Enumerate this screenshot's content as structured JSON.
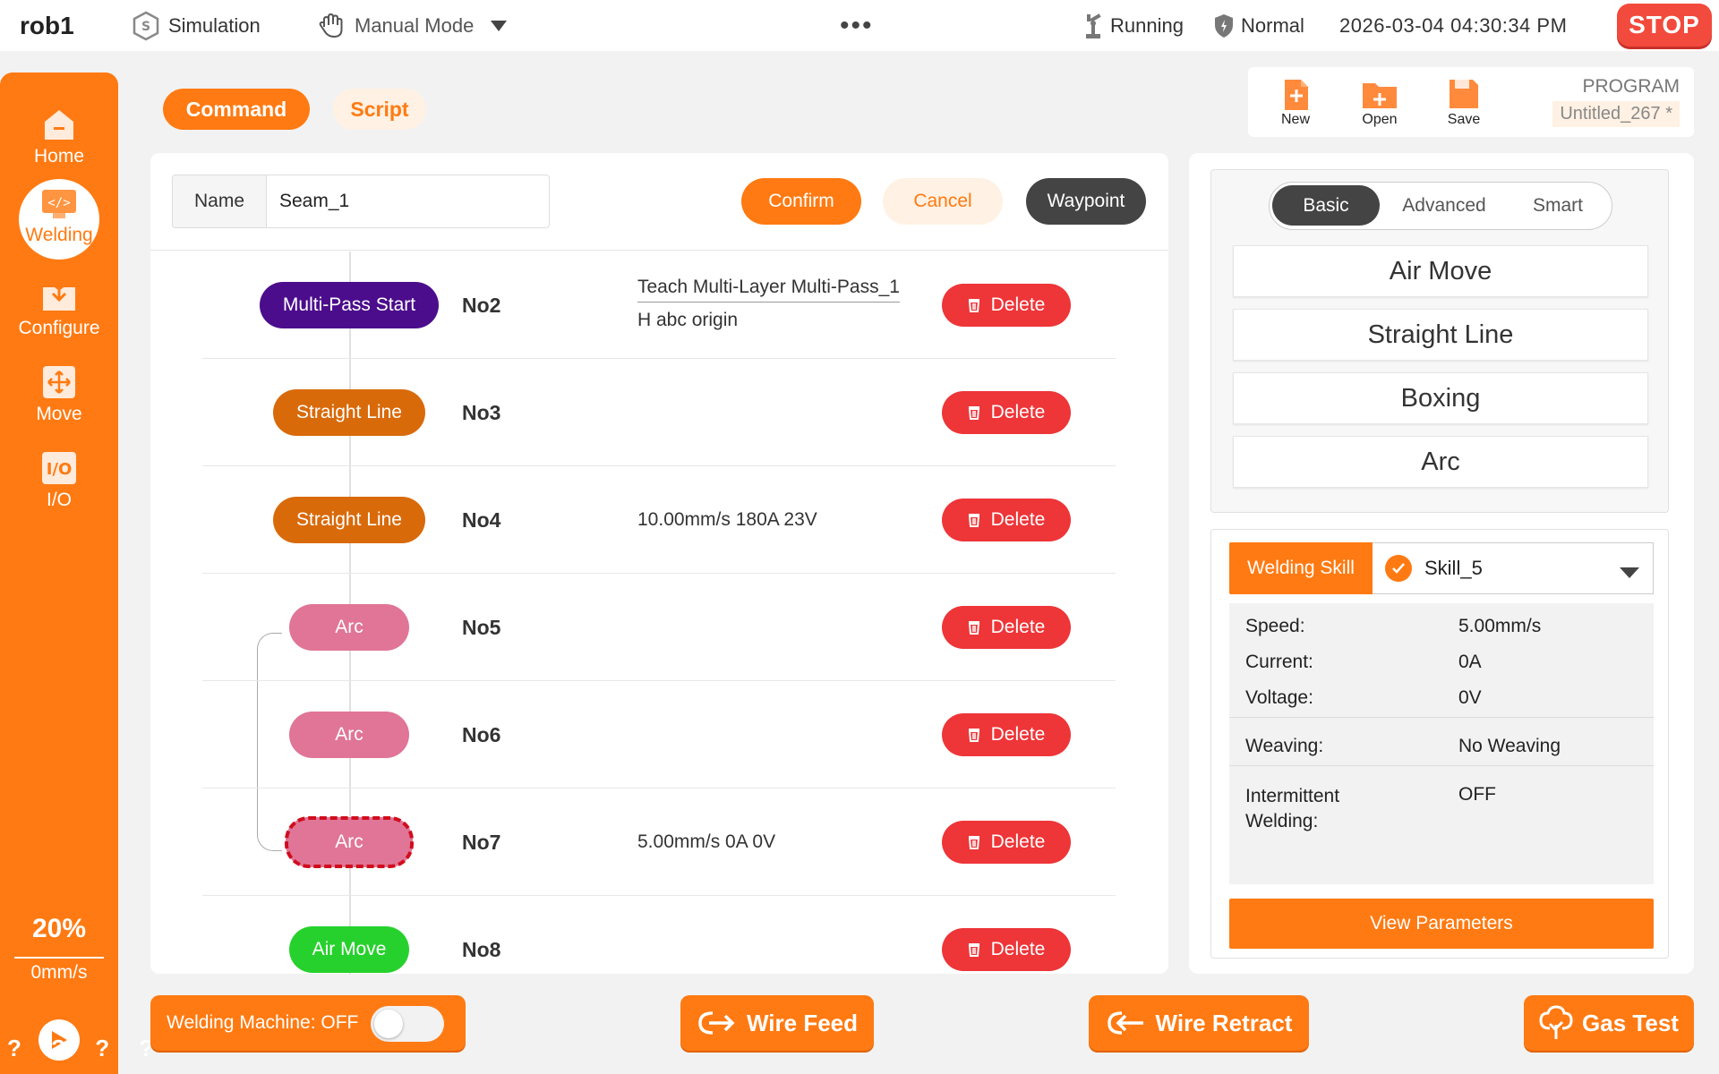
{
  "topbar": {
    "robot_name": "rob1",
    "simulation": "Simulation",
    "mode": "Manual Mode",
    "more": "•••",
    "state": "Running",
    "safety": "Normal",
    "datetime": "2026-03-04 04:30:34 PM",
    "stop": "STOP"
  },
  "sidebar": {
    "items": [
      {
        "label": "Home",
        "icon": "home-icon"
      },
      {
        "label": "Welding",
        "icon": "code-icon"
      },
      {
        "label": "Configure",
        "icon": "download-icon"
      },
      {
        "label": "Move",
        "icon": "move-icon"
      },
      {
        "label": "I/O",
        "icon": "io-icon"
      }
    ],
    "speed_percent": "20%",
    "speed_mm": "0mm/s",
    "qmarks": "? ? ? ?"
  },
  "tabs": {
    "command": "Command",
    "script": "Script"
  },
  "program": {
    "new": "New",
    "open": "Open",
    "save": "Save",
    "label": "PROGRAM",
    "name": "Untitled_267 *"
  },
  "editor": {
    "name_label": "Name",
    "name_value": "Seam_1",
    "confirm": "Confirm",
    "cancel": "Cancel",
    "waypoint": "Waypoint"
  },
  "rows": [
    {
      "type": "Multi-Pass Start",
      "no": "No2",
      "desc1": "Teach Multi-Layer Multi-Pass_1",
      "desc2": "H abc origin",
      "delete": "Delete"
    },
    {
      "type": "Straight Line",
      "no": "No3",
      "desc": "",
      "delete": "Delete"
    },
    {
      "type": "Straight Line",
      "no": "No4",
      "desc": "10.00mm/s 180A 23V",
      "delete": "Delete"
    },
    {
      "type": "Arc",
      "no": "No5",
      "desc": "",
      "delete": "Delete"
    },
    {
      "type": "Arc",
      "no": "No6",
      "desc": "",
      "delete": "Delete"
    },
    {
      "type": "Arc",
      "no": "No7",
      "desc": "5.00mm/s 0A 0V",
      "delete": "Delete"
    },
    {
      "type": "Air Move",
      "no": "No8",
      "desc": "",
      "delete": "Delete"
    }
  ],
  "commands": {
    "segments": [
      "Basic",
      "Advanced",
      "Smart"
    ],
    "buttons": [
      "Air Move",
      "Straight Line",
      "Boxing",
      "Arc"
    ]
  },
  "skill": {
    "label": "Welding Skill",
    "selected": "Skill_5",
    "params": [
      {
        "k": "Speed:",
        "v": "5.00mm/s"
      },
      {
        "k": "Current:",
        "v": "0A"
      },
      {
        "k": "Voltage:",
        "v": "0V"
      },
      {
        "k": "Weaving:",
        "v": "No Weaving"
      },
      {
        "k": "Intermittent Welding:",
        "v": "OFF"
      }
    ],
    "view": "View Parameters"
  },
  "bottom": {
    "welding_machine": "Welding Machine: OFF",
    "wire_feed": "Wire Feed",
    "wire_retract": "Wire Retract",
    "gas_test": "Gas Test"
  },
  "colors": {
    "accent": "#ff7a12",
    "multi_pass": "#4b0d8c",
    "straight_line": "#d96a0a",
    "arc": "#e07597",
    "air_move": "#27d12d",
    "delete": "#ee3538",
    "stop": "#f24a3c"
  }
}
